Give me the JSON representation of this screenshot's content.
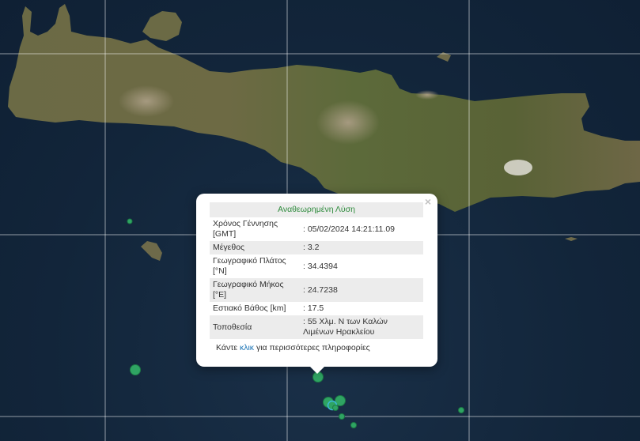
{
  "popup": {
    "title": "Αναθεωρημένη Λύση",
    "close_glyph": "×",
    "rows": [
      {
        "label": "Χρόνος Γέννησης [GMT]",
        "value": ": 05/02/2024 14:21:11.09"
      },
      {
        "label": "Μέγεθος",
        "value": ": 3.2"
      },
      {
        "label": "Γεωγραφικό Πλάτος [°N]",
        "value": ": 34.4394"
      },
      {
        "label": "Γεωγραφικό Μήκος [°E]",
        "value": ": 24.7238"
      },
      {
        "label": "Εστιακό Βάθος [km]",
        "value": ": 17.5"
      },
      {
        "label": "Τοποθεσία",
        "value": ": 55 Χλμ. Ν των Καλών Λιμένων Ηρακλείου"
      }
    ],
    "more_prefix": "Κάντε ",
    "more_link": "κλικ",
    "more_suffix": " για περισσότερες πληροφορίες"
  },
  "colors": {
    "sea": "#13263a",
    "marker_fill": "#2fa463",
    "marker_stroke": "#1c7a45",
    "header_text": "#2e8b3c",
    "link": "#1a73b5"
  }
}
